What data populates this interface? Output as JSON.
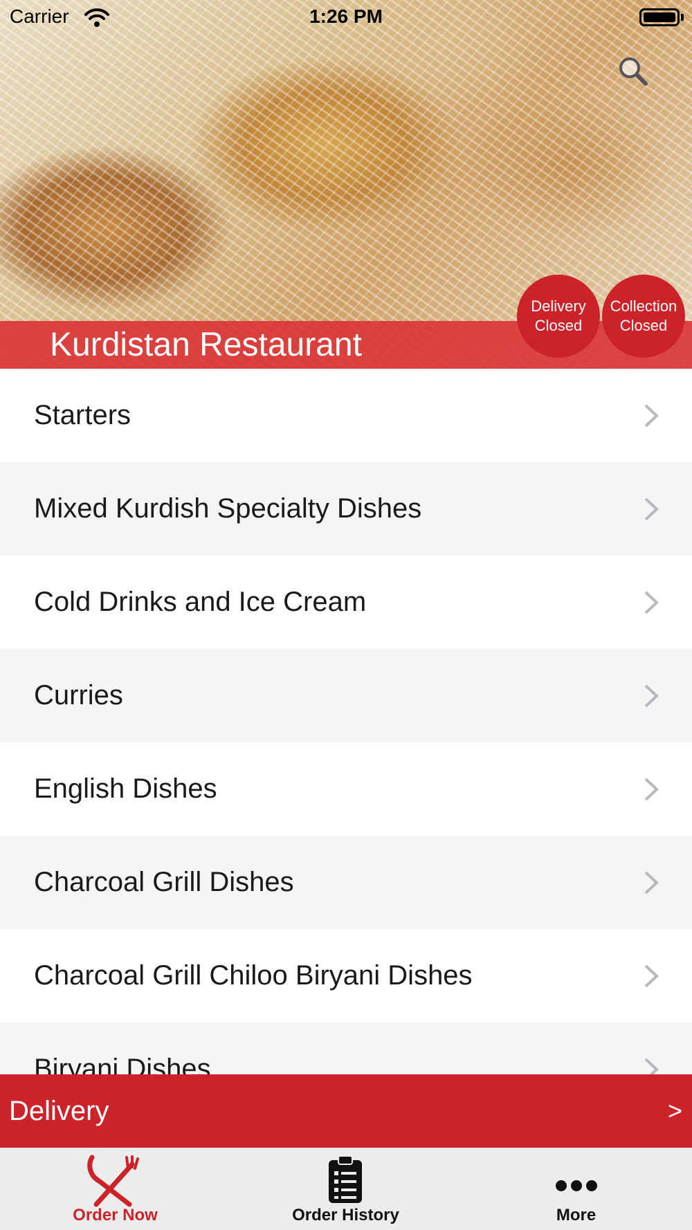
{
  "status_bar": {
    "carrier": "Carrier",
    "time": "1:26 PM"
  },
  "hero": {
    "restaurant_name": "Kurdistan Restaurant",
    "delivery_status": {
      "line1": "Delivery",
      "line2": "Closed"
    },
    "collection_status": {
      "line1": "Collection",
      "line2": "Closed"
    },
    "search_icon": "search-icon"
  },
  "categories": [
    "Starters",
    "Mixed Kurdish Specialty Dishes",
    "Cold Drinks and Ice Cream",
    "Curries",
    "English Dishes",
    "Charcoal Grill Dishes",
    "Charcoal Grill Chiloo Biryani Dishes",
    "Biryani Dishes"
  ],
  "delivery_bar": {
    "label": "Delivery",
    "arrow": ">"
  },
  "tabs": [
    {
      "label": "Order Now",
      "icon": "fork-knife-icon",
      "active": true
    },
    {
      "label": "Order History",
      "icon": "clipboard-list-icon",
      "active": false
    },
    {
      "label": "More",
      "icon": "more-dots-icon",
      "active": false
    }
  ],
  "colors": {
    "brand_red": "#cc2229",
    "list_alt_bg": "#f4f5f7",
    "tab_bar_bg": "#ececec"
  }
}
